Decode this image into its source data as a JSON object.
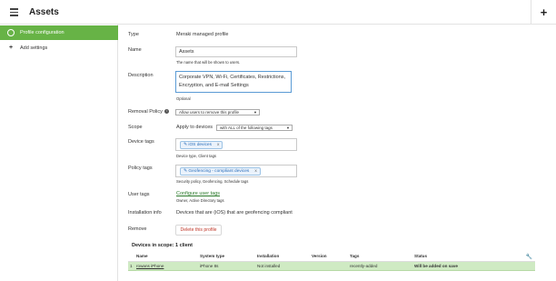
{
  "header": {
    "title": "Assets",
    "add_icon": "plus-icon",
    "menu_icon": "hamburger-icon"
  },
  "sidebar": {
    "items": [
      {
        "label": "Profile configuration",
        "icon": "gear-icon",
        "active": true
      },
      {
        "label": "Add settings",
        "icon": "plus-icon",
        "active": false
      }
    ],
    "accent": "#67b346"
  },
  "form": {
    "type": {
      "label": "Type",
      "value": "Meraki managed profile"
    },
    "name": {
      "label": "Name",
      "value": "Assets",
      "hint": "The name that will be shown to users."
    },
    "description": {
      "label": "Description",
      "line1": "Corporate VPN, Wi-Fi, Certificates, Restrictions,",
      "line2": "Encryption, and E-mail Settings",
      "hint": "Optional"
    },
    "removal_policy": {
      "label": "Removal Policy",
      "info_icon": "info-icon",
      "value": "Allow users to remove this profile"
    },
    "scope": {
      "label": "Scope",
      "prefix": "Apply to devices",
      "value": "with ALL of the following tags"
    },
    "device_tags": {
      "label": "Device tags",
      "chip": "iOS devices",
      "hint": "Device type, Client tags"
    },
    "policy_tags": {
      "label": "Policy tags",
      "chip": "Geofencing - compliant devices",
      "hint": "Security policy, Geofencing, Schedule tags"
    },
    "user_tags": {
      "label": "User tags",
      "link": "Configure user tags",
      "hint": "Owner, Active Directory tags"
    },
    "installation_info": {
      "label": "Installation info",
      "value": "Devices that are (iOS) that are geofencing compliant"
    },
    "remove": {
      "label": "Remove",
      "button": "Delete this profile"
    }
  },
  "devices": {
    "title": "Devices in scope: 1 client",
    "columns": [
      "Name",
      "System type",
      "Installation",
      "Version",
      "Tags",
      "Status"
    ],
    "rows": [
      {
        "index": "1",
        "name": "rowans iPhone",
        "system_type": "iPhone 8s",
        "installation": "Not installed",
        "version": "",
        "tags": "recently-added",
        "status": "Will be added on save"
      }
    ],
    "row_color": "#cfeac3",
    "wrench_icon": "wrench-icon"
  }
}
